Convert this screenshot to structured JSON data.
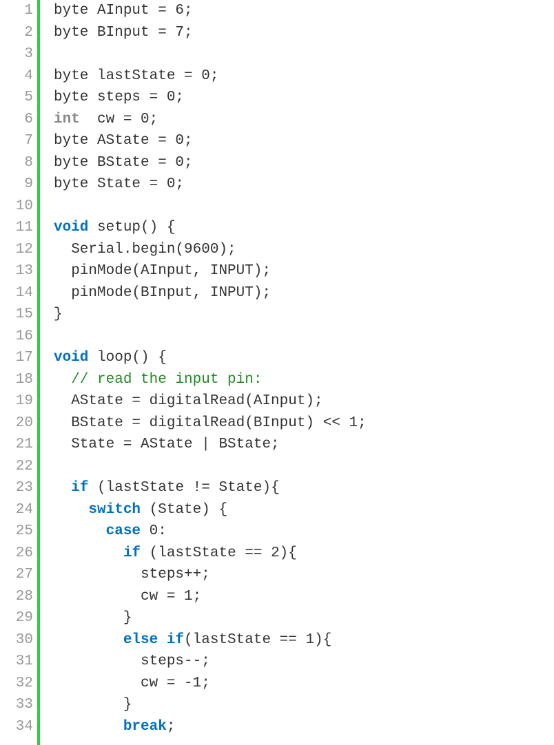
{
  "lines": [
    {
      "n": "1",
      "seg": [
        [
          "norm",
          "byte AInput = 6;"
        ]
      ]
    },
    {
      "n": "2",
      "seg": [
        [
          "norm",
          "byte BInput = 7;"
        ]
      ]
    },
    {
      "n": "3",
      "seg": [
        [
          "norm",
          ""
        ]
      ]
    },
    {
      "n": "4",
      "seg": [
        [
          "norm",
          "byte lastState = 0;"
        ]
      ]
    },
    {
      "n": "5",
      "seg": [
        [
          "norm",
          "byte steps = 0;"
        ]
      ]
    },
    {
      "n": "6",
      "seg": [
        [
          "type",
          "int"
        ],
        [
          "norm",
          "  cw = 0;"
        ]
      ]
    },
    {
      "n": "7",
      "seg": [
        [
          "norm",
          "byte AState = 0;"
        ]
      ]
    },
    {
      "n": "8",
      "seg": [
        [
          "norm",
          "byte BState = 0;"
        ]
      ]
    },
    {
      "n": "9",
      "seg": [
        [
          "norm",
          "byte State = 0;"
        ]
      ]
    },
    {
      "n": "10",
      "seg": [
        [
          "norm",
          ""
        ]
      ]
    },
    {
      "n": "11",
      "seg": [
        [
          "kw",
          "void"
        ],
        [
          "norm",
          " setup() {"
        ]
      ]
    },
    {
      "n": "12",
      "seg": [
        [
          "norm",
          "  Serial.begin(9600);"
        ]
      ]
    },
    {
      "n": "13",
      "seg": [
        [
          "norm",
          "  pinMode(AInput, INPUT);"
        ]
      ]
    },
    {
      "n": "14",
      "seg": [
        [
          "norm",
          "  pinMode(BInput, INPUT);"
        ]
      ]
    },
    {
      "n": "15",
      "seg": [
        [
          "norm",
          "}"
        ]
      ]
    },
    {
      "n": "16",
      "seg": [
        [
          "norm",
          ""
        ]
      ]
    },
    {
      "n": "17",
      "seg": [
        [
          "kw",
          "void"
        ],
        [
          "norm",
          " loop() {"
        ]
      ]
    },
    {
      "n": "18",
      "seg": [
        [
          "norm",
          "  "
        ],
        [
          "comment",
          "// read the input pin:"
        ]
      ]
    },
    {
      "n": "19",
      "seg": [
        [
          "norm",
          "  AState = digitalRead(AInput);"
        ]
      ]
    },
    {
      "n": "20",
      "seg": [
        [
          "norm",
          "  BState = digitalRead(BInput) << 1;"
        ]
      ]
    },
    {
      "n": "21",
      "seg": [
        [
          "norm",
          "  State = AState | BState;"
        ]
      ]
    },
    {
      "n": "22",
      "seg": [
        [
          "norm",
          ""
        ]
      ]
    },
    {
      "n": "23",
      "seg": [
        [
          "norm",
          "  "
        ],
        [
          "kw",
          "if"
        ],
        [
          "norm",
          " (lastState != State){"
        ]
      ]
    },
    {
      "n": "24",
      "seg": [
        [
          "norm",
          "    "
        ],
        [
          "kw",
          "switch"
        ],
        [
          "norm",
          " (State) {"
        ]
      ]
    },
    {
      "n": "25",
      "seg": [
        [
          "norm",
          "      "
        ],
        [
          "kw",
          "case"
        ],
        [
          "norm",
          " 0:"
        ]
      ]
    },
    {
      "n": "26",
      "seg": [
        [
          "norm",
          "        "
        ],
        [
          "kw",
          "if"
        ],
        [
          "norm",
          " (lastState == 2){"
        ]
      ]
    },
    {
      "n": "27",
      "seg": [
        [
          "norm",
          "          steps++;"
        ]
      ]
    },
    {
      "n": "28",
      "seg": [
        [
          "norm",
          "          cw = 1;"
        ]
      ]
    },
    {
      "n": "29",
      "seg": [
        [
          "norm",
          "        }"
        ]
      ]
    },
    {
      "n": "30",
      "seg": [
        [
          "norm",
          "        "
        ],
        [
          "kw",
          "else if"
        ],
        [
          "norm",
          "(lastState == 1){"
        ]
      ]
    },
    {
      "n": "31",
      "seg": [
        [
          "norm",
          "          steps--;"
        ]
      ]
    },
    {
      "n": "32",
      "seg": [
        [
          "norm",
          "          cw = -1;"
        ]
      ]
    },
    {
      "n": "33",
      "seg": [
        [
          "norm",
          "        }"
        ]
      ]
    },
    {
      "n": "34",
      "seg": [
        [
          "norm",
          "        "
        ],
        [
          "kw",
          "break"
        ],
        [
          "norm",
          ";"
        ]
      ]
    }
  ]
}
